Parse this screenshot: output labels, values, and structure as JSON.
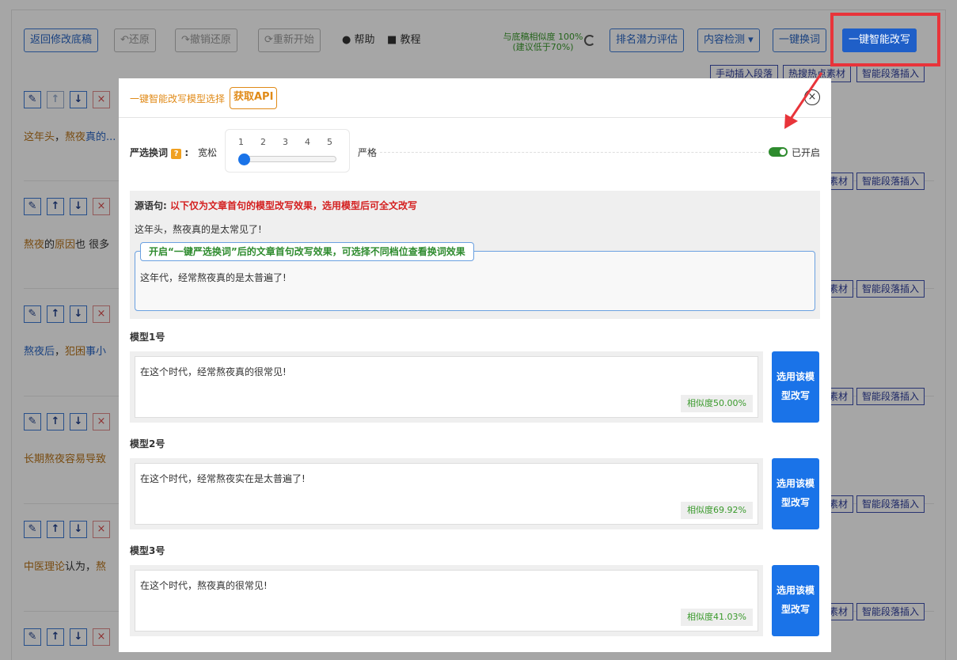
{
  "toolbar": {
    "back_label": "返回修改底稿",
    "undo_label": "还原",
    "redo_label": "撤销还原",
    "restart_label": "重新开始",
    "help_label": "帮助",
    "tutorial_label": "教程",
    "similarity_line1": "与底稿相似度 100%",
    "similarity_line2": "(建议低于70%)",
    "ranking_label": "排名潜力评估",
    "content_check_label": "内容检测",
    "one_click_replace_label": "一键换词",
    "smart_rewrite_label": "一键智能改写"
  },
  "side_buttons": {
    "manual_insert": "手动插入段落",
    "hot_material": "热搜热点素材",
    "smart_insert": "智能段落插入",
    "material_short": "素材"
  },
  "rows": [
    {
      "text_a": "这年头",
      "text_b": "，",
      "text_c": "熬夜",
      "text_d": "真的..."
    },
    {
      "text_a": "熬夜",
      "text_b": "的",
      "text_c": "原因",
      "text_d": "也 很多"
    },
    {
      "text_a": "熬夜后",
      "text_b": "，",
      "text_c": "犯困",
      "text_d": "事小"
    },
    {
      "text_a": "长期熬夜",
      "text_b": "容易",
      "text_c": "导致",
      "text_d": ""
    },
    {
      "text_a": "中医理论",
      "text_b": "认为",
      "text_c": "，",
      "text_d": "熬"
    }
  ],
  "modal": {
    "title": "一键智能改写模型选择",
    "api_button": "获取API",
    "strict_label": "严选换词",
    "loose_label": "宽松",
    "strict_end_label": "严格",
    "slider_ticks": [
      "1",
      "2",
      "3",
      "4",
      "5"
    ],
    "slider_value": 1,
    "toggle_label": "已开启",
    "toggle_on": true,
    "source_head_label": "源语句:",
    "source_head_note": "以下仅为文章首句的模型改写效果，选用模型后可全文改写",
    "source_sentence": "这年头，熬夜真的是太常见了!",
    "preview_legend": "开启“一键严选换词”后的文章首句改写效果，可选择不同档位查看换词效果",
    "preview_text": "这年代，经常熬夜真的是太普遍了!",
    "use_button_line1": "选用该模",
    "use_button_line2": "型改写",
    "models": [
      {
        "label": "模型1号",
        "text": "在这个时代，经常熬夜真的很常见!",
        "similarity": "相似度50.00%"
      },
      {
        "label": "模型2号",
        "text": "在这个时代，经常熬夜实在是太普遍了!",
        "similarity": "相似度69.92%"
      },
      {
        "label": "模型3号",
        "text": "在这个时代，熬夜真的很常见!",
        "similarity": "相似度41.03%"
      }
    ]
  },
  "colors": {
    "primary": "#1f5fc8",
    "accent_orange": "#e08a17",
    "highlight_red": "#e8343a",
    "success_green": "#3a9a2c"
  }
}
